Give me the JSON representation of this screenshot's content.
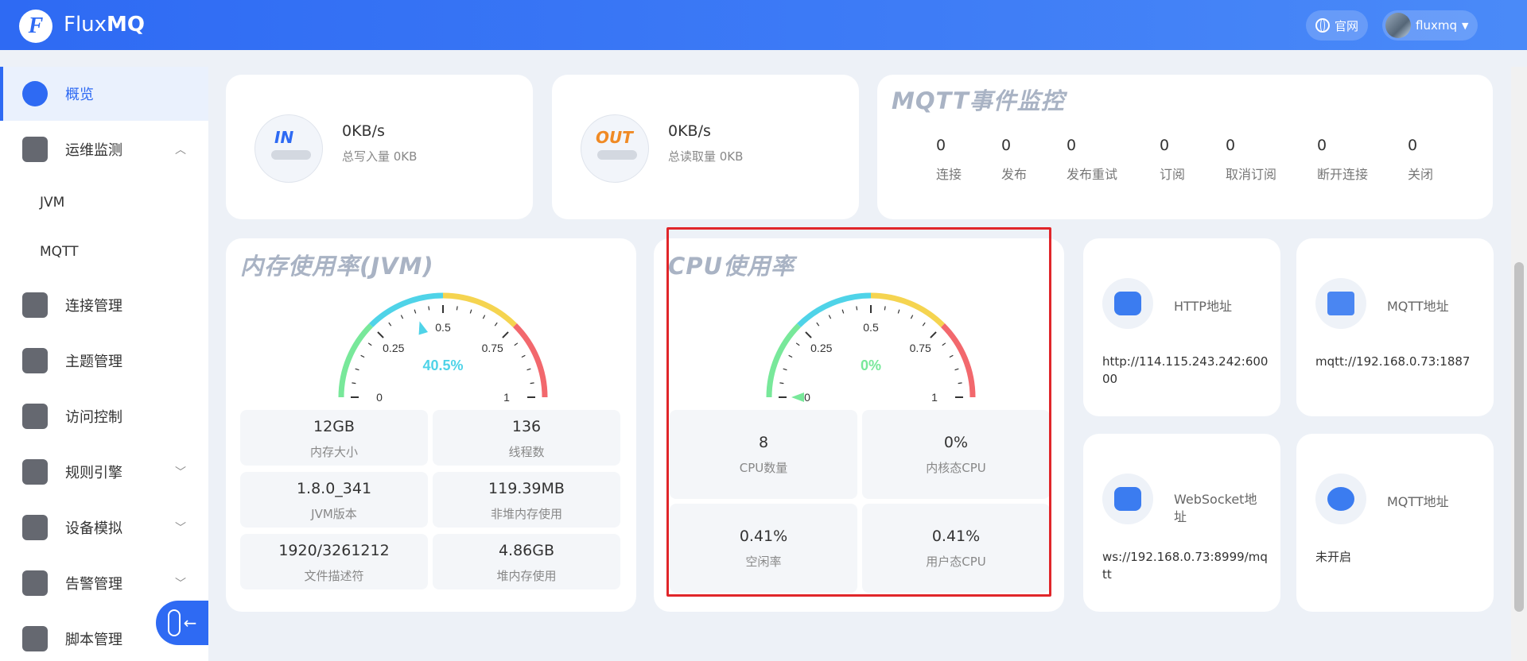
{
  "header": {
    "brand_a": "Flux",
    "brand_b": "MQ",
    "site_label": "官网",
    "user": "fluxmq"
  },
  "sidebar": {
    "items": [
      {
        "label": "概览"
      },
      {
        "label": "运维监测"
      },
      {
        "label": "JVM"
      },
      {
        "label": "MQTT"
      },
      {
        "label": "连接管理"
      },
      {
        "label": "主题管理"
      },
      {
        "label": "访问控制"
      },
      {
        "label": "规则引擎"
      },
      {
        "label": "设备模拟"
      },
      {
        "label": "告警管理"
      },
      {
        "label": "脚本管理"
      }
    ]
  },
  "traffic": {
    "in": {
      "badge": "IN",
      "value": "0KB/s",
      "sub": "总写入量 0KB"
    },
    "out": {
      "badge": "OUT",
      "value": "0KB/s",
      "sub": "总读取量 0KB"
    }
  },
  "events": {
    "title": "MQTT事件监控",
    "items": [
      {
        "value": "0",
        "label": "连接"
      },
      {
        "value": "0",
        "label": "发布"
      },
      {
        "value": "0",
        "label": "发布重试"
      },
      {
        "value": "0",
        "label": "订阅"
      },
      {
        "value": "0",
        "label": "取消订阅"
      },
      {
        "value": "0",
        "label": "断开连接"
      },
      {
        "value": "0",
        "label": "关闭"
      }
    ]
  },
  "memory": {
    "title": "内存使用率(JVM)",
    "gauge_value": 0.405,
    "gauge_text": "40.5%",
    "ticks": [
      "0",
      "0.25",
      "0.5",
      "0.75",
      "1"
    ],
    "stats": [
      {
        "value": "12GB",
        "label": "内存大小"
      },
      {
        "value": "136",
        "label": "线程数"
      },
      {
        "value": "1.8.0_341",
        "label": "JVM版本"
      },
      {
        "value": "119.39MB",
        "label": "非堆内存使用"
      },
      {
        "value": "1920/3261212",
        "label": "文件描述符"
      },
      {
        "value": "4.86GB",
        "label": "堆内存使用"
      }
    ]
  },
  "cpu": {
    "title": "CPU使用率",
    "gauge_value": 0,
    "gauge_text": "0%",
    "ticks": [
      "0",
      "0.25",
      "0.5",
      "0.75",
      "1"
    ],
    "stats": [
      {
        "value": "8",
        "label": "CPU数量"
      },
      {
        "value": "0%",
        "label": "内核态CPU"
      },
      {
        "value": "0.41%",
        "label": "空闲率"
      },
      {
        "value": "0.41%",
        "label": "用户态CPU"
      }
    ]
  },
  "addresses": [
    {
      "title": "HTTP地址",
      "value": "http://114.115.243.242:60000"
    },
    {
      "title": "MQTT地址",
      "value": "mqtt://192.168.0.73:1887"
    },
    {
      "title": "WebSocket地址",
      "value": "ws://192.168.0.73:8999/mqtt"
    },
    {
      "title": "MQTT地址",
      "value": "未开启"
    }
  ],
  "colors": {
    "primary": "#2e6af3",
    "gauge_cyan": "#4fd3e8",
    "gauge_green": "#78e89a",
    "gauge_yellow": "#f5d450",
    "gauge_red": "#f2686d",
    "highlight": "#e0262a"
  }
}
